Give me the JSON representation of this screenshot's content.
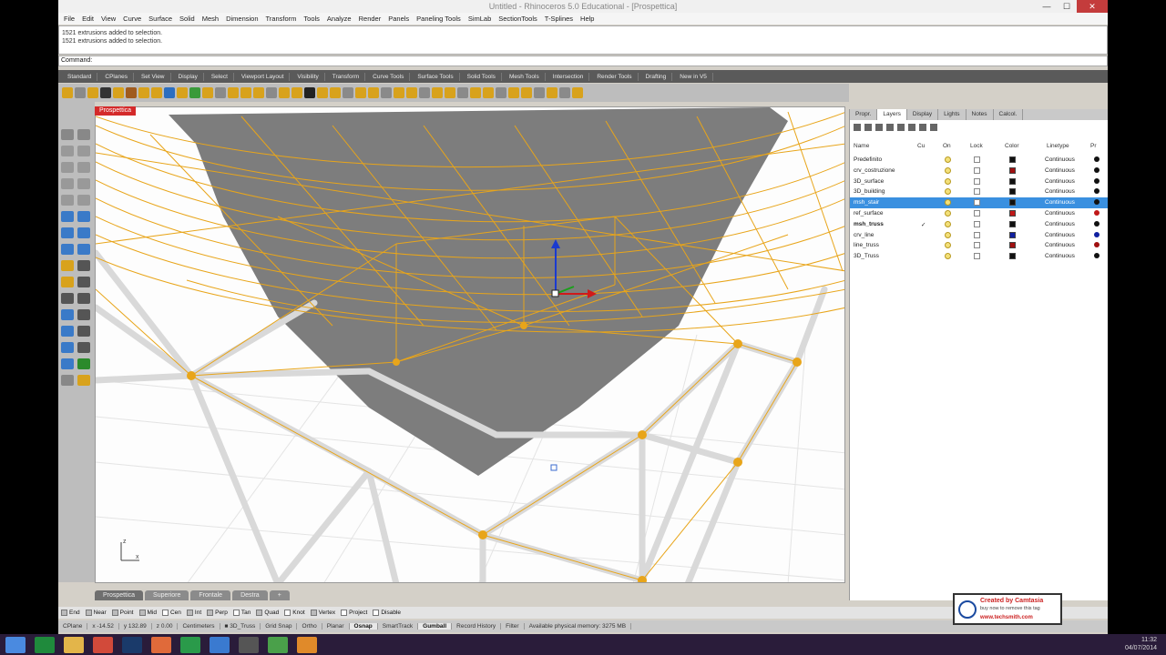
{
  "window": {
    "title": "Untitled - Rhinoceros 5.0 Educational - [Prospettica]",
    "min": "—",
    "max": "☐",
    "close": "✕"
  },
  "menu": [
    "File",
    "Edit",
    "View",
    "Curve",
    "Surface",
    "Solid",
    "Mesh",
    "Dimension",
    "Transform",
    "Tools",
    "Analyze",
    "Render",
    "Panels",
    "Paneling Tools",
    "SimLab",
    "SectionTools",
    "T-Splines",
    "Help"
  ],
  "history": [
    "1521 extrusions added to selection.",
    "1521 extrusions added to selection."
  ],
  "command": {
    "label": "Command:",
    "value": ""
  },
  "toolbar_tabs": [
    "Standard",
    "CPlanes",
    "Set View",
    "Display",
    "Select",
    "Viewport Layout",
    "Visibility",
    "Transform",
    "Curve Tools",
    "Surface Tools",
    "Solid Tools",
    "Mesh Tools",
    "Intersection",
    "Render Tools",
    "Drafting",
    "New in V5"
  ],
  "viewport": {
    "label": "Prospettica",
    "axis_y": "z",
    "axis_x": "x"
  },
  "viewport_tabs": [
    "Prospettica",
    "Superiore",
    "Frontale",
    "Destra",
    "+"
  ],
  "panel": {
    "tabs": [
      "Propr.",
      "Layers",
      "Display",
      "Lights",
      "Notes",
      "Calcol."
    ],
    "headers": {
      "name": "Name",
      "current": "Cu",
      "on": "On",
      "lock": "Lock",
      "color": "Color",
      "linetype": "Linetype",
      "print": "Pr"
    },
    "layers": [
      {
        "name": "Predefinito",
        "current": "",
        "linetype": "Continuous",
        "color": "#111111",
        "print": "#111111",
        "selected": false,
        "bold": false
      },
      {
        "name": "crv_costruzione",
        "current": "",
        "linetype": "Continuous",
        "color": "#a01010",
        "print": "#111111",
        "selected": false,
        "bold": false
      },
      {
        "name": "3D_surface",
        "current": "",
        "linetype": "Continuous",
        "color": "#111111",
        "print": "#111111",
        "selected": false,
        "bold": false
      },
      {
        "name": "3D_building",
        "current": "",
        "linetype": "Continuous",
        "color": "#111111",
        "print": "#111111",
        "selected": false,
        "bold": false
      },
      {
        "name": "msh_stair",
        "current": "",
        "linetype": "Continuous",
        "color": "#111111",
        "print": "#111111",
        "selected": true,
        "bold": false
      },
      {
        "name": "ref_surface",
        "current": "",
        "linetype": "Continuous",
        "color": "#c01818",
        "print": "#c01818",
        "selected": false,
        "bold": false
      },
      {
        "name": "msh_truss",
        "current": "✓",
        "linetype": "Continuous",
        "color": "#111111",
        "print": "#111111",
        "selected": false,
        "bold": true
      },
      {
        "name": "crv_line",
        "current": "",
        "linetype": "Continuous",
        "color": "#1020a0",
        "print": "#1020a0",
        "selected": false,
        "bold": false
      },
      {
        "name": "line_truss",
        "current": "",
        "linetype": "Continuous",
        "color": "#a01010",
        "print": "#a01010",
        "selected": false,
        "bold": false
      },
      {
        "name": "3D_Truss",
        "current": "",
        "linetype": "Continuous",
        "color": "#111111",
        "print": "#111111",
        "selected": false,
        "bold": false
      }
    ]
  },
  "osnap": [
    {
      "label": "End",
      "on": true
    },
    {
      "label": "Near",
      "on": true
    },
    {
      "label": "Point",
      "on": true
    },
    {
      "label": "Mid",
      "on": true
    },
    {
      "label": "Cen",
      "on": false
    },
    {
      "label": "Int",
      "on": true
    },
    {
      "label": "Perp",
      "on": true
    },
    {
      "label": "Tan",
      "on": false
    },
    {
      "label": "Quad",
      "on": true
    },
    {
      "label": "Knot",
      "on": false
    },
    {
      "label": "Vertex",
      "on": true
    },
    {
      "label": "Project",
      "on": false
    },
    {
      "label": "Disable",
      "on": false
    }
  ],
  "status": [
    {
      "text": "CPlane",
      "bold": false
    },
    {
      "text": "x -14.52",
      "bold": false
    },
    {
      "text": "y 132.89",
      "bold": false
    },
    {
      "text": "z 0.00",
      "bold": false
    },
    {
      "text": "Centimeters",
      "bold": false
    },
    {
      "text": "■ 3D_Truss",
      "bold": false
    },
    {
      "text": "Grid Snap",
      "bold": false
    },
    {
      "text": "Ortho",
      "bold": false
    },
    {
      "text": "Planar",
      "bold": false
    },
    {
      "text": "Osnap",
      "bold": true
    },
    {
      "text": "SmartTrack",
      "bold": false
    },
    {
      "text": "Gumball",
      "bold": true
    },
    {
      "text": "Record History",
      "bold": false
    },
    {
      "text": "Filter",
      "bold": false
    },
    {
      "text": "Available physical memory: 3275 MB",
      "bold": false
    }
  ],
  "stamp": {
    "line1": "Created by Camtasia",
    "line2": "buy now to remove this tag",
    "line3": "www.techsmith.com"
  },
  "clock": {
    "time": "11:32",
    "date": "04/07/2014"
  },
  "colors": {
    "truss": "#e8a51a",
    "tube": "#d9d9d9",
    "surface": "#7d7d7d",
    "selection": "#3a90e0"
  }
}
